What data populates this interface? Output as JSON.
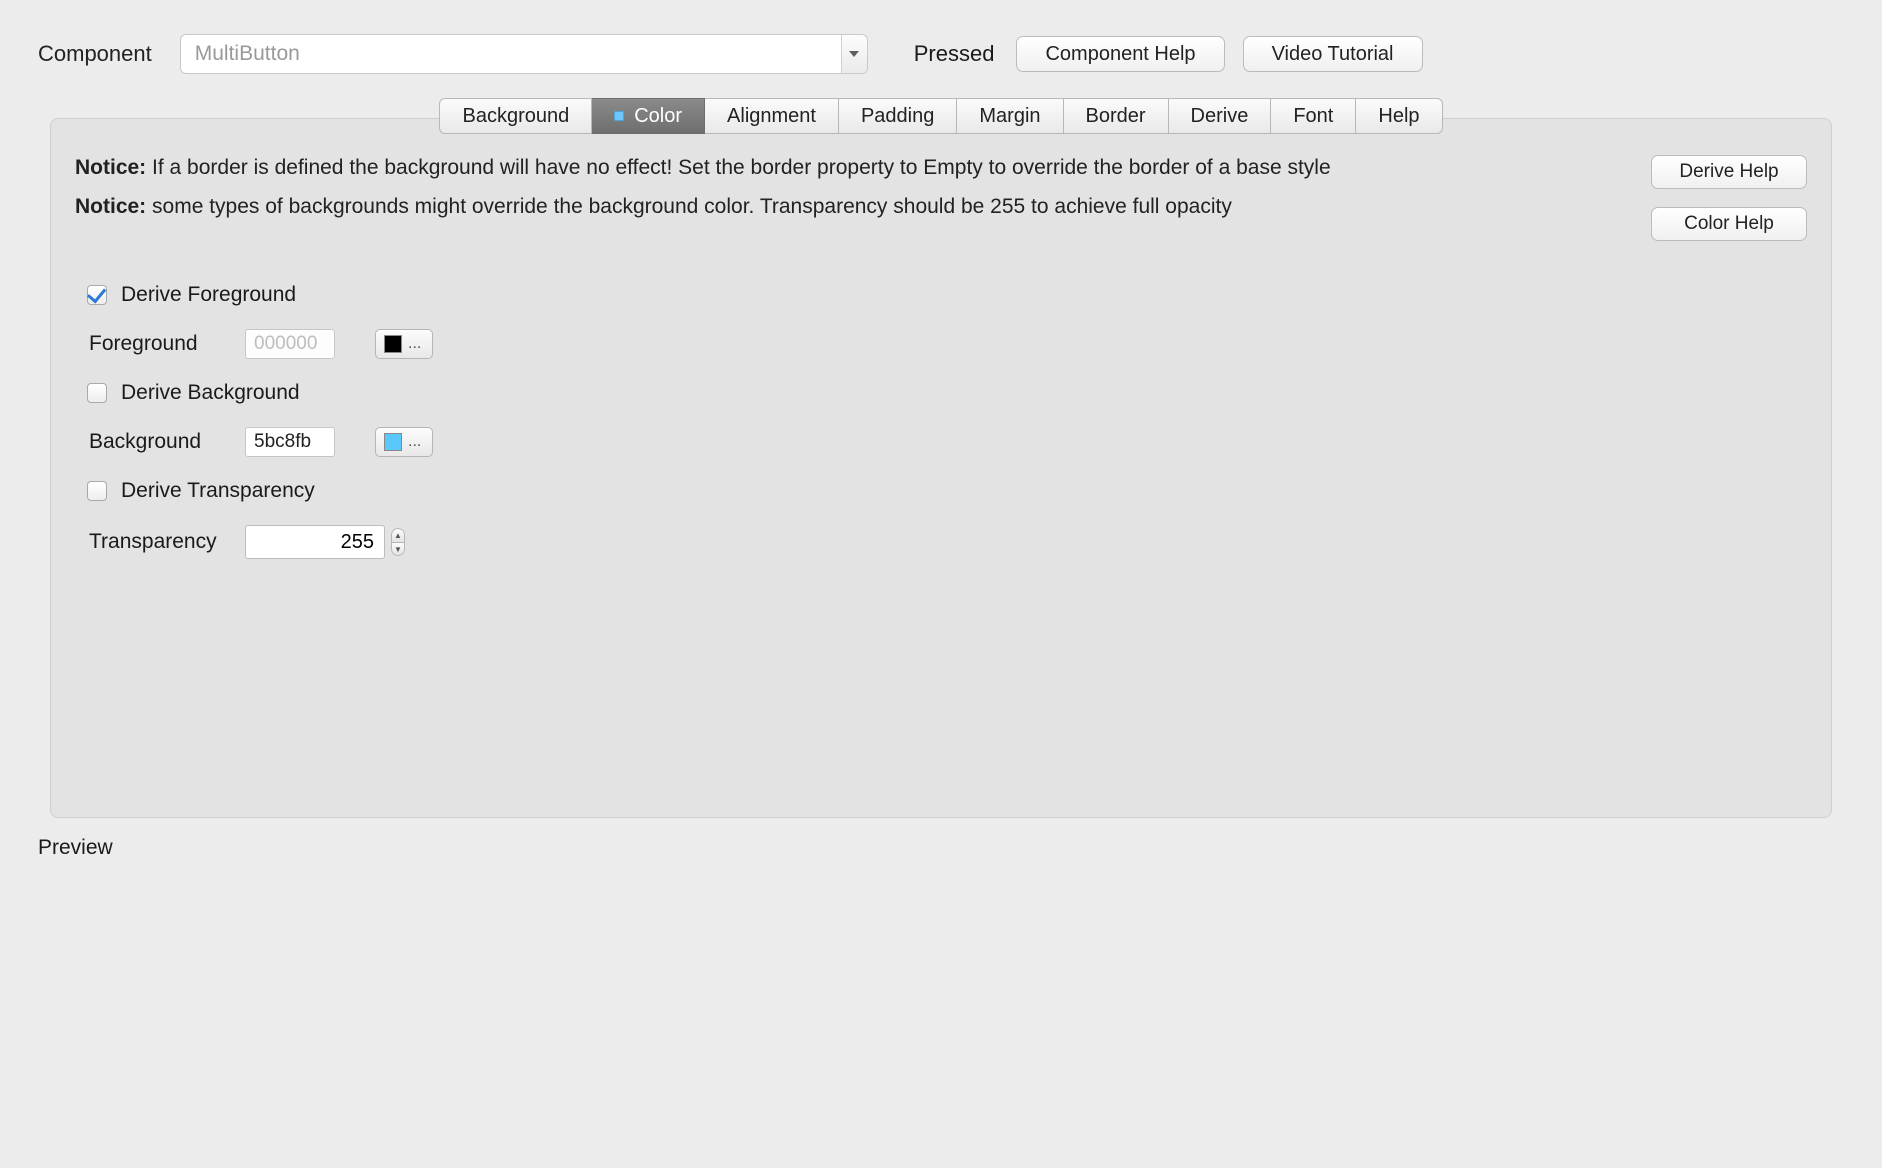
{
  "top": {
    "component_label": "Component",
    "component_value": "MultiButton",
    "pressed_label": "Pressed",
    "component_help": "Component Help",
    "video_tutorial": "Video Tutorial"
  },
  "tabs": {
    "background": "Background",
    "color": "Color",
    "alignment": "Alignment",
    "padding": "Padding",
    "margin": "Margin",
    "border": "Border",
    "derive": "Derive",
    "font": "Font",
    "help": "Help"
  },
  "notices": {
    "n1_bold": "Notice:",
    "n1_text": "If a border is defined the background will have no effect! Set the border property to Empty to override the border of a base style",
    "n2_bold": "Notice:",
    "n2_text": "some types of backgrounds might override the background color. Transparency should be 255 to achieve full opacity"
  },
  "helps": {
    "derive": "Derive Help",
    "color": "Color Help"
  },
  "form": {
    "derive_fg_label": "Derive Foreground",
    "derive_fg_checked": true,
    "fg_label": "Foreground",
    "fg_value": "000000",
    "fg_swatch": "#000000",
    "derive_bg_label": "Derive Background",
    "derive_bg_checked": false,
    "bg_label": "Background",
    "bg_value": "5bc8fb",
    "bg_swatch": "#5bc8fb",
    "derive_tr_label": "Derive Transparency",
    "derive_tr_checked": false,
    "tr_label": "Transparency",
    "tr_value": "255",
    "ellipsis": "..."
  },
  "preview_label": "Preview"
}
